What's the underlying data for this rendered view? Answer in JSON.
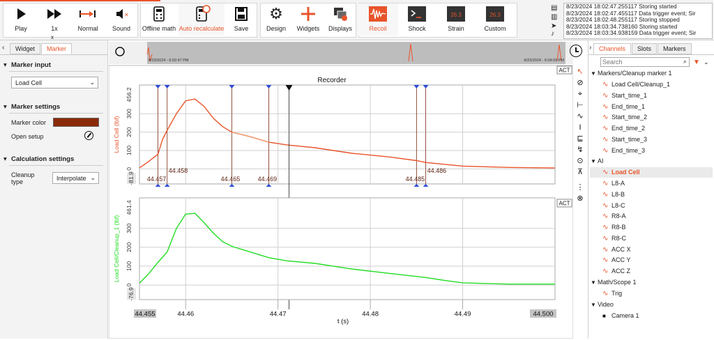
{
  "toolbar": {
    "play": "Play",
    "speed": "1x",
    "speed_sub": "x",
    "normal": "Normal",
    "sound": "Sound",
    "offline_math": "Offline math",
    "auto_recalc": "Auto recalculate",
    "save": "Save",
    "design": "Design",
    "widgets": "Widgets",
    "displays": "Displays",
    "recoil": "Recoil",
    "shock": "Shock",
    "strain": "Strain",
    "custom": "Custom",
    "strain_icon_text": "26.3",
    "custom_icon_text": "26.3"
  },
  "log": [
    "8/23/2024 18:02:47.255117 Storing started",
    "8/23/2024 18:02:47.455117 Data trigger event; Sir",
    "8/23/2024 18:02:48.255117 Storing stopped",
    "8/23/2024 18:03:34.738160 Storing started",
    "8/23/2024 18:03:34.938159 Data trigger event; Sir"
  ],
  "left": {
    "tab_widget": "Widget",
    "tab_marker": "Marker",
    "marker_input": "Marker input",
    "marker_input_value": "Load Cell",
    "marker_settings": "Marker settings",
    "marker_color_label": "Marker color",
    "marker_color": "#8b2a08",
    "open_setup": "Open setup",
    "calc_settings": "Calculation settings",
    "cleanup_label": "Cleanup type",
    "cleanup_line1": "Cleanup",
    "cleanup_line2": "type",
    "cleanup_value": "Interpolate"
  },
  "overview": {
    "start_time": "8/23/2024 - 6:02:47 PM",
    "end_time": "8/23/2024 - 6:04:03 PM"
  },
  "recorder": {
    "title": "Recorder",
    "act": "ACT",
    "act2": "ACT",
    "xlabel": "t (s)",
    "x_start": "44.455",
    "x_end": "44.500",
    "x_ticks": [
      "44.46",
      "44.47",
      "44.48",
      "44.49"
    ],
    "top_ylabel": "Load Cell (lbf)",
    "top_ymax": "456.2",
    "top_ymin": "-81.9",
    "top_yticks": [
      "300",
      "200",
      "100",
      "0"
    ],
    "bot_ylabel": "Load Cell/Cleanup_1 (lbf)",
    "bot_ymax": "461.4",
    "bot_ymin": "-76.9",
    "bot_yticks": [
      "300",
      "200",
      "100",
      "0"
    ],
    "markers": [
      "44.457",
      "44.458",
      "44.465",
      "44.469",
      "44.485",
      "44.486"
    ]
  },
  "colors": {
    "accent": "#e8542a",
    "top_trace": "#e8542a",
    "cleanup_segment": "#f2a07a",
    "bottom_trace": "#22dd22"
  },
  "channels": {
    "search_placeholder": "Search",
    "tabs": [
      "Channels",
      "Slots",
      "Markers"
    ],
    "groups": [
      {
        "name": "Markers/Cleanup marker 1",
        "items": [
          "Load Cell/Cleanup_1",
          "Start_time_1",
          "End_time_1",
          "Start_time_2",
          "End_time_2",
          "Start_time_3",
          "End_time_3"
        ]
      },
      {
        "name": "AI",
        "items": [
          "Load Cell",
          "L8-A",
          "L8-B",
          "L8-C",
          "R8-A",
          "R8-B",
          "R8-C",
          "ACC X",
          "ACC Y",
          "ACC Z"
        ]
      },
      {
        "name": "Math/Scope 1",
        "items": [
          "Trig"
        ]
      },
      {
        "name": "Video",
        "items": [
          "Camera 1"
        ]
      }
    ]
  },
  "chart_data": {
    "type": "line",
    "xlabel": "t (s)",
    "xlim": [
      44.455,
      44.5
    ],
    "series": [
      {
        "name": "Load Cell (lbf)",
        "ylim": [
          -81.9,
          456.2
        ],
        "x": [
          44.455,
          44.456,
          44.457,
          44.4575,
          44.458,
          44.459,
          44.46,
          44.461,
          44.462,
          44.463,
          44.464,
          44.465,
          44.467,
          44.469,
          44.471,
          44.474,
          44.478,
          44.482,
          44.485,
          44.486,
          44.488,
          44.49,
          44.495,
          44.5
        ],
        "y": [
          5,
          40,
          80,
          160,
          210,
          300,
          370,
          380,
          340,
          275,
          230,
          200,
          175,
          145,
          130,
          115,
          85,
          65,
          45,
          35,
          25,
          15,
          8,
          5
        ]
      },
      {
        "name": "Load Cell/Cleanup_1 (lbf)",
        "ylim": [
          -76.9,
          461.4
        ],
        "x": [
          44.455,
          44.456,
          44.457,
          44.458,
          44.459,
          44.46,
          44.461,
          44.462,
          44.463,
          44.464,
          44.465,
          44.467,
          44.469,
          44.471,
          44.474,
          44.478,
          44.482,
          44.486,
          44.488,
          44.49,
          44.495,
          44.5
        ],
        "y": [
          10,
          60,
          120,
          175,
          300,
          375,
          380,
          330,
          275,
          230,
          205,
          175,
          145,
          128,
          115,
          85,
          62,
          40,
          25,
          12,
          5,
          5
        ]
      }
    ],
    "markers_x": [
      44.457,
      44.458,
      44.465,
      44.469,
      44.485,
      44.486
    ]
  }
}
